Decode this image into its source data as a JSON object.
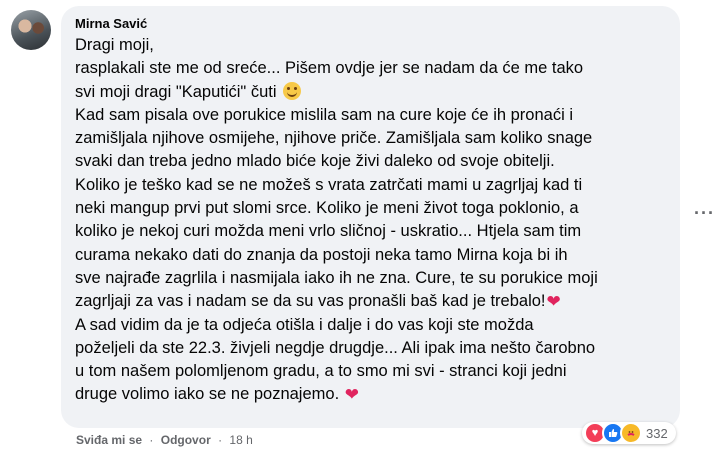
{
  "comment": {
    "author": "Mirna Savić",
    "lines": [
      "Dragi moji,",
      "rasplakali ste me od sreće... Pišem ovdje jer se nadam da će me tako",
      "svi moji dragi \"Kaputići\" čuti",
      "Kad sam pisala ove porukice mislila sam na cure koje će ih pronaći i",
      "zamišljala njihove osmijehe, njihove priče. Zamišljala sam koliko snage",
      "svaki dan treba jedno mlado biće koje živi daleko od svoje obitelji.",
      "Koliko je teško kad se ne možeš s vrata zatrčati mami u zagrljaj kad ti",
      "neki mangup prvi put slomi srce. Koliko je meni život toga poklonio, a",
      "koliko je nekoj curi možda meni vrlo sličnoj - uskratio... Htjela sam tim",
      "curama nekako dati do znanja da postoji neka tamo Mirna koja bi ih",
      "sve najrađe zagrlila i nasmijala iako ih ne zna. Cure, te su porukice moji",
      "zagrljaji za vas i nadam se da su vas pronašli baš kad je trebalo!",
      "A sad vidim da je ta odjeća otišla i dalje i do vas koji ste možda",
      "poželjeli da ste 22.3. živjeli negdje drugdje... Ali ipak ima nešto čarobno",
      "u tom našem polomljenom gradu, a to smo mi svi - stranci koji jedni",
      "druge volimo iako se ne poznajemo. "
    ],
    "heart": "❤",
    "more_glyph": "···"
  },
  "actions": {
    "like": "Sviđa mi se",
    "reply": "Odgovor",
    "separator": "·",
    "time": "18 h"
  },
  "reactions": {
    "count": "332",
    "types": [
      "love-icon",
      "like-icon",
      "care-icon"
    ]
  }
}
